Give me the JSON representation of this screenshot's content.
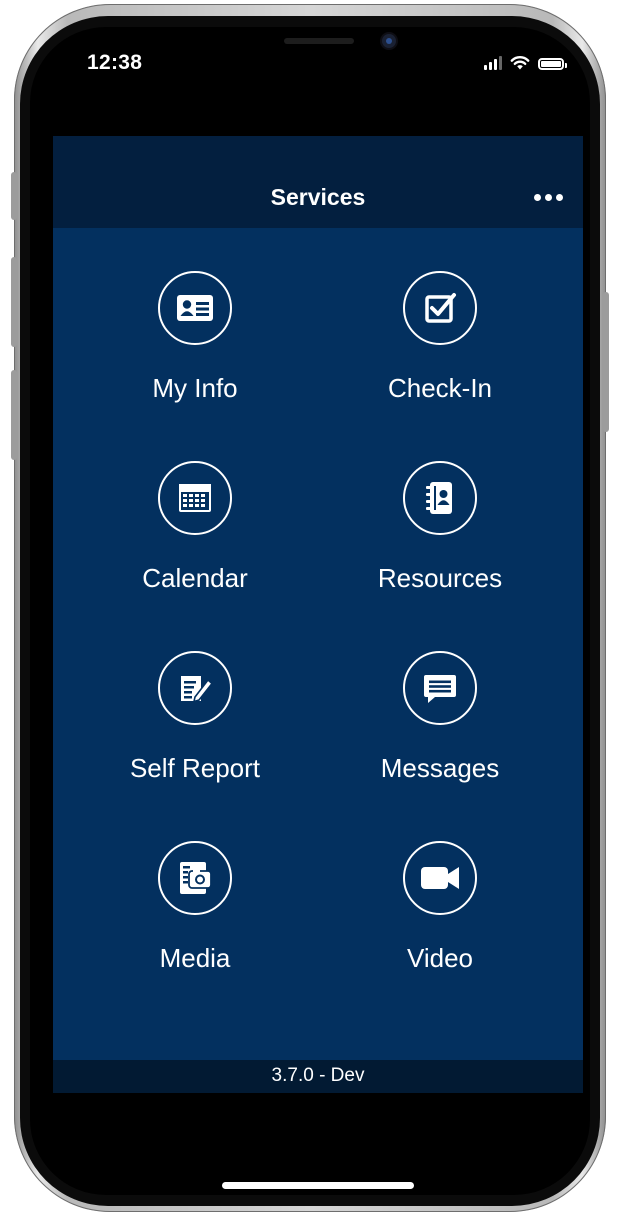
{
  "status_bar": {
    "time": "12:38"
  },
  "navbar": {
    "title": "Services",
    "more_icon": "more-horizontal-icon"
  },
  "tiles": [
    {
      "label": "My Info",
      "icon": "id-card-icon"
    },
    {
      "label": "Check-In",
      "icon": "checkbox-icon"
    },
    {
      "label": "Calendar",
      "icon": "calendar-icon"
    },
    {
      "label": "Resources",
      "icon": "address-book-icon"
    },
    {
      "label": "Self Report",
      "icon": "edit-document-icon"
    },
    {
      "label": "Messages",
      "icon": "message-bubble-icon"
    },
    {
      "label": "Media",
      "icon": "camera-icon"
    },
    {
      "label": "Video",
      "icon": "video-camera-icon"
    }
  ],
  "footer": {
    "version": "3.7.0 - Dev"
  },
  "colors": {
    "background": "#03305f",
    "navbar": "#031f3f",
    "footer": "#021a33",
    "text": "#ffffff"
  }
}
